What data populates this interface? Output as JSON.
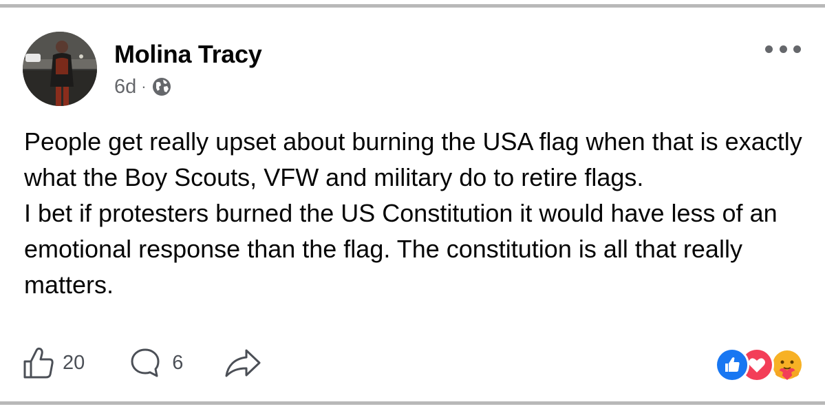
{
  "post": {
    "author": "Molina Tracy",
    "time": "6d",
    "separator": "·",
    "privacy_icon": "globe-icon",
    "menu_icon": "more-options-icon",
    "text_paragraphs": [
      "People get really upset about burning the USA flag when that is exactly what the Boy Scouts, VFW and military do to retire flags.",
      "I bet if protesters burned the US Constitution it would have less of an emotional response than the flag. The constitution is all that really matters."
    ]
  },
  "actions": {
    "like": {
      "icon": "thumbs-up-icon",
      "count": "20"
    },
    "comment": {
      "icon": "comment-bubble-icon",
      "count": "6"
    },
    "share": {
      "icon": "share-arrow-icon"
    }
  },
  "reactions": [
    {
      "icon": "like-reaction-icon",
      "color": "#1877f2"
    },
    {
      "icon": "love-reaction-icon",
      "color": "#f33e58"
    },
    {
      "icon": "care-reaction-icon",
      "color": "#f7b125"
    }
  ],
  "colors": {
    "text": "#050505",
    "secondary": "#65676b",
    "divider": "#b8b8b8",
    "like_blue": "#1877f2",
    "love_red": "#f33e58",
    "care_yellow": "#f7b125"
  }
}
